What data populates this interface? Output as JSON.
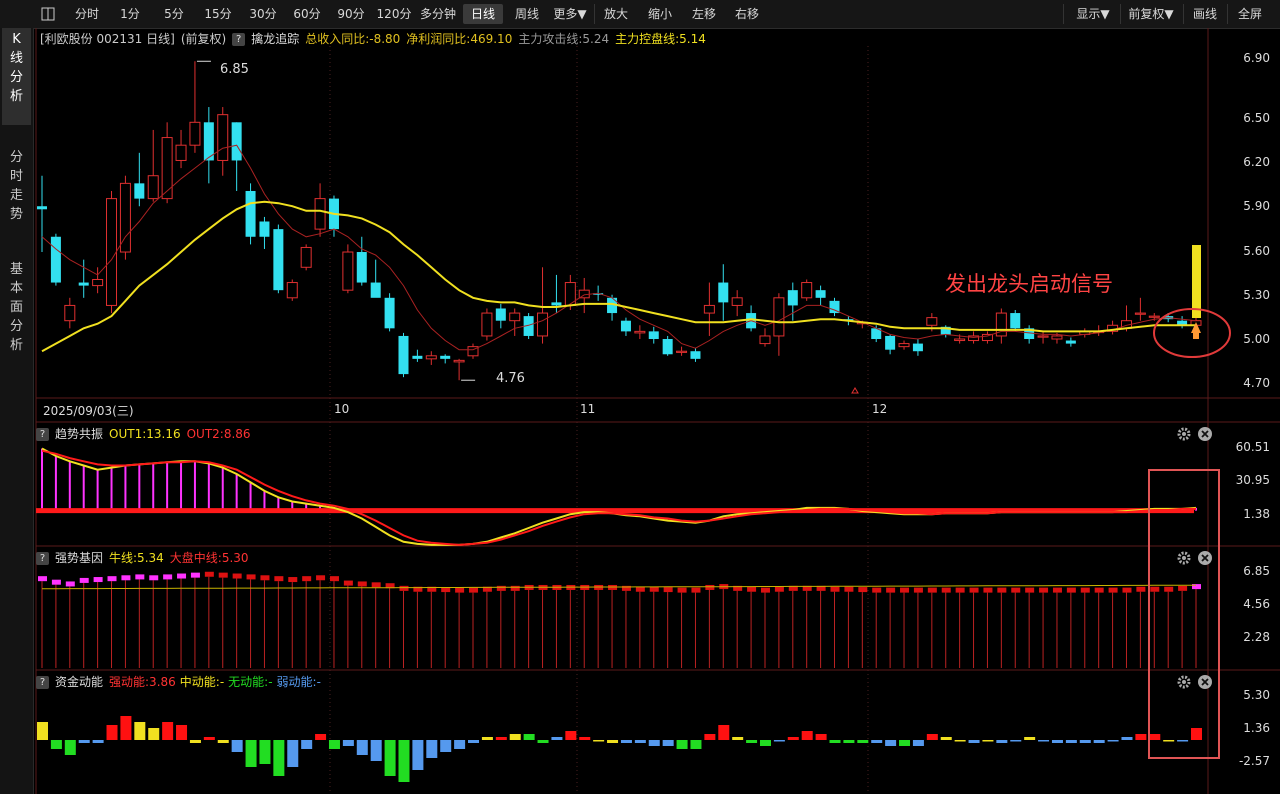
{
  "toolbar": {
    "items": [
      {
        "label": "分时"
      },
      {
        "label": "1分"
      },
      {
        "label": "5分"
      },
      {
        "label": "15分"
      },
      {
        "label": "30分"
      },
      {
        "label": "60分"
      },
      {
        "label": "90分"
      },
      {
        "label": "120分"
      },
      {
        "label": "多分钟"
      },
      {
        "label": "日线",
        "active": true
      },
      {
        "label": "周线"
      },
      {
        "label": "更多▼"
      },
      {
        "label": "放大"
      },
      {
        "label": "缩小"
      },
      {
        "label": "左移"
      },
      {
        "label": "右移"
      }
    ],
    "right": [
      {
        "label": "显示▼"
      },
      {
        "label": "前复权▼"
      },
      {
        "label": "画线"
      },
      {
        "label": "全屏"
      }
    ]
  },
  "sidebar": {
    "tabs": [
      {
        "label": "K\n线\n分\n析",
        "active": true
      },
      {
        "label": "分\n时\n走\n势"
      },
      {
        "label": "基\n本\n面\n分\n析"
      }
    ]
  },
  "main": {
    "stock": "[利欧股份 002131 日线]",
    "adjust": "(前复权)",
    "indicator": "擒龙追踪",
    "stat1": "总收入同比:-8.80",
    "stat2": "净利润同比:469.10",
    "stat3": "主力攻击线:5.24",
    "stat4": "主力控盘线:5.14",
    "annotation": "发出龙头启动信号",
    "high_label": "6.85",
    "low_label": "4.76",
    "axis": [
      "6.90",
      "6.50",
      "6.20",
      "5.90",
      "5.60",
      "5.30",
      "5.00",
      "4.70"
    ],
    "dates": [
      "2025/09/03(三)",
      "10",
      "11",
      "12"
    ]
  },
  "panel1": {
    "title": "趋势共振",
    "out1": "OUT1:13.16",
    "out2": "OUT2:8.86",
    "axis": [
      "60.51",
      "30.95",
      "1.38"
    ]
  },
  "panel2": {
    "title": "强势基因",
    "niu": "牛线:5.34",
    "dapan": "大盘中线:5.30",
    "axis": [
      "6.85",
      "4.56",
      "2.28"
    ]
  },
  "panel3": {
    "title": "资金动能",
    "strong": "强动能:3.86",
    "mid": "中动能:-",
    "none": "无动能:-",
    "weak": "弱动能:-",
    "axis": [
      "5.30",
      "1.36",
      "-2.57"
    ]
  },
  "colors": {
    "up": "#e03030",
    "down": "#33e0f0",
    "yellow": "#f0e020",
    "magenta": "#ff33ff",
    "green": "#22cc22",
    "blue": "#5599ee",
    "red": "#ff1a1a"
  },
  "chart_data": {
    "type": "candlestick",
    "ylim": [
      4.65,
      6.95
    ],
    "candles": [
      [
        5.9,
        5.88,
        6.1,
        5.6
      ],
      [
        5.7,
        5.4,
        5.72,
        5.38
      ],
      [
        5.15,
        5.25,
        5.3,
        5.1
      ],
      [
        5.4,
        5.38,
        5.55,
        5.3
      ],
      [
        5.38,
        5.42,
        5.5,
        5.33
      ],
      [
        5.25,
        5.95,
        6.0,
        5.2
      ],
      [
        5.6,
        6.05,
        6.1,
        5.55
      ],
      [
        6.05,
        5.95,
        6.25,
        5.9
      ],
      [
        5.95,
        6.1,
        6.4,
        5.93
      ],
      [
        5.95,
        6.35,
        6.45,
        5.92
      ],
      [
        6.2,
        6.3,
        6.4,
        6.15
      ],
      [
        6.3,
        6.45,
        6.85,
        6.25
      ],
      [
        6.45,
        6.2,
        6.55,
        6.05
      ],
      [
        6.2,
        6.5,
        6.55,
        6.1
      ],
      [
        6.45,
        6.2,
        6.45,
        6.0
      ],
      [
        6.0,
        5.7,
        6.05,
        5.65
      ],
      [
        5.8,
        5.7,
        5.83,
        5.62
      ],
      [
        5.75,
        5.35,
        5.78,
        5.33
      ],
      [
        5.3,
        5.4,
        5.42,
        5.28
      ],
      [
        5.5,
        5.63,
        5.65,
        5.48
      ],
      [
        5.75,
        5.95,
        6.05,
        5.7
      ],
      [
        5.95,
        5.75,
        5.97,
        5.7
      ],
      [
        5.35,
        5.6,
        5.65,
        5.33
      ],
      [
        5.6,
        5.4,
        5.7,
        5.38
      ],
      [
        5.4,
        5.3,
        5.55,
        5.32
      ],
      [
        5.3,
        5.1,
        5.33,
        5.08
      ],
      [
        5.05,
        4.8,
        5.07,
        4.78
      ],
      [
        4.92,
        4.9,
        4.96,
        4.88
      ],
      [
        4.9,
        4.92,
        4.95,
        4.86
      ],
      [
        4.92,
        4.9,
        4.93,
        4.87
      ],
      [
        4.88,
        4.89,
        4.9,
        4.76
      ],
      [
        4.92,
        4.98,
        5.0,
        4.9
      ],
      [
        5.05,
        5.2,
        5.23,
        5.02
      ],
      [
        5.23,
        5.15,
        5.26,
        5.1
      ],
      [
        5.15,
        5.2,
        5.23,
        5.05
      ],
      [
        5.18,
        5.05,
        5.2,
        5.03
      ],
      [
        5.05,
        5.2,
        5.5,
        5.0
      ],
      [
        5.27,
        5.25,
        5.45,
        5.2
      ],
      [
        5.25,
        5.4,
        5.45,
        5.22
      ],
      [
        5.3,
        5.35,
        5.43,
        5.2
      ],
      [
        5.33,
        5.32,
        5.38,
        5.28
      ],
      [
        5.3,
        5.2,
        5.32,
        5.15
      ],
      [
        5.15,
        5.08,
        5.17,
        5.05
      ],
      [
        5.07,
        5.08,
        5.12,
        5.03
      ],
      [
        5.08,
        5.03,
        5.11,
        5.0
      ],
      [
        5.03,
        4.93,
        5.05,
        4.92
      ],
      [
        4.95,
        4.95,
        4.98,
        4.92
      ],
      [
        4.95,
        4.9,
        4.97,
        4.88
      ],
      [
        5.2,
        5.25,
        5.4,
        5.05
      ],
      [
        5.4,
        5.27,
        5.52,
        5.15
      ],
      [
        5.25,
        5.3,
        5.35,
        5.18
      ],
      [
        5.2,
        5.1,
        5.25,
        5.08
      ],
      [
        5.0,
        5.05,
        5.1,
        4.98
      ],
      [
        5.05,
        5.3,
        5.33,
        4.92
      ],
      [
        5.35,
        5.25,
        5.4,
        5.15
      ],
      [
        5.3,
        5.4,
        5.42,
        5.28
      ],
      [
        5.35,
        5.3,
        5.38,
        5.25
      ],
      [
        5.28,
        5.2,
        5.3,
        5.18
      ],
      [
        5.16,
        5.15,
        5.18,
        5.12
      ],
      [
        5.13,
        5.14,
        5.15,
        5.1
      ],
      [
        5.1,
        5.03,
        5.12,
        5.01
      ],
      [
        5.05,
        4.96,
        5.06,
        4.93
      ],
      [
        4.98,
        5.0,
        5.02,
        4.96
      ],
      [
        5.0,
        4.95,
        5.03,
        4.92
      ],
      [
        5.12,
        5.17,
        5.2,
        5.08
      ],
      [
        5.11,
        5.06,
        5.12,
        5.04
      ],
      [
        5.02,
        5.03,
        5.06,
        5.0
      ],
      [
        5.02,
        5.05,
        5.08,
        5.0
      ],
      [
        5.02,
        5.06,
        5.08,
        5.0
      ],
      [
        5.05,
        5.2,
        5.23,
        5.0
      ],
      [
        5.2,
        5.1,
        5.22,
        5.08
      ],
      [
        5.1,
        5.03,
        5.12,
        5.0
      ],
      [
        5.05,
        5.05,
        5.08,
        5.0
      ],
      [
        5.03,
        5.05,
        5.07,
        5.0
      ],
      [
        5.02,
        5.0,
        5.04,
        4.98
      ],
      [
        5.06,
        5.08,
        5.1,
        5.04
      ],
      [
        5.08,
        5.08,
        5.12,
        5.05
      ],
      [
        5.08,
        5.12,
        5.15,
        5.06
      ],
      [
        5.1,
        5.15,
        5.25,
        5.08
      ],
      [
        5.2,
        5.2,
        5.3,
        5.15
      ],
      [
        5.18,
        5.18,
        5.2,
        5.15
      ],
      [
        5.18,
        5.16,
        5.2,
        5.14
      ],
      [
        5.15,
        5.12,
        5.18,
        5.1
      ],
      [
        5.12,
        5.15,
        5.18,
        5.1
      ]
    ],
    "ma_fast": [
      5.7,
      5.62,
      5.55,
      5.5,
      5.45,
      5.55,
      5.7,
      5.8,
      5.92,
      6.0,
      6.08,
      6.15,
      6.22,
      6.28,
      6.3,
      6.15,
      5.98,
      5.85,
      5.75,
      5.7,
      5.72,
      5.75,
      5.7,
      5.62,
      5.58,
      5.5,
      5.38,
      5.22,
      5.1,
      5.02,
      4.96,
      4.96,
      5.0,
      5.05,
      5.1,
      5.12,
      5.15,
      5.2,
      5.26,
      5.32,
      5.33,
      5.3,
      5.22,
      5.16,
      5.12,
      5.08,
      5.0,
      4.97,
      5.02,
      5.08,
      5.12,
      5.15,
      5.12,
      5.15,
      5.2,
      5.25,
      5.25,
      5.22,
      5.18,
      5.14,
      5.1,
      5.06,
      5.04,
      5.03,
      5.05,
      5.06,
      5.05,
      5.04,
      5.05,
      5.08,
      5.08,
      5.07,
      5.06,
      5.06,
      5.05,
      5.06,
      5.07,
      5.09,
      5.12,
      5.14,
      5.16,
      5.17,
      5.16,
      5.15
    ],
    "ma_slow": [
      4.95,
      5.0,
      5.05,
      5.1,
      5.13,
      5.18,
      5.28,
      5.38,
      5.45,
      5.52,
      5.6,
      5.68,
      5.75,
      5.82,
      5.88,
      5.92,
      5.93,
      5.92,
      5.9,
      5.87,
      5.87,
      5.85,
      5.84,
      5.82,
      5.78,
      5.73,
      5.65,
      5.58,
      5.5,
      5.42,
      5.35,
      5.3,
      5.28,
      5.27,
      5.27,
      5.25,
      5.24,
      5.24,
      5.25,
      5.26,
      5.26,
      5.26,
      5.24,
      5.22,
      5.2,
      5.18,
      5.16,
      5.14,
      5.14,
      5.14,
      5.15,
      5.16,
      5.15,
      5.14,
      5.14,
      5.15,
      5.16,
      5.16,
      5.15,
      5.14,
      5.13,
      5.11,
      5.1,
      5.1,
      5.1,
      5.1,
      5.09,
      5.09,
      5.09,
      5.09,
      5.09,
      5.09,
      5.08,
      5.08,
      5.08,
      5.08,
      5.08,
      5.09,
      5.1,
      5.11,
      5.12,
      5.12,
      5.12,
      5.12
    ],
    "trend_out1": [
      60,
      53,
      48,
      44,
      40,
      42,
      44,
      45,
      46,
      47,
      48,
      48,
      46,
      42,
      36,
      28,
      20,
      14,
      10,
      8,
      6,
      4,
      0,
      -6,
      -14,
      -22,
      -28,
      -30,
      -31,
      -31,
      -31,
      -30,
      -28,
      -24,
      -20,
      -15,
      -10,
      -6,
      -2,
      0,
      0,
      -1,
      -3,
      -4,
      -6,
      -8,
      -9,
      -10,
      -8,
      -4,
      -2,
      -1,
      0,
      1,
      2,
      4,
      4,
      4,
      3,
      1,
      0,
      -1,
      -2,
      -2,
      -2,
      -1,
      -1,
      -1,
      -1,
      0,
      0,
      0,
      0,
      0,
      0,
      0,
      0,
      0,
      1,
      2,
      3,
      3,
      3,
      4
    ],
    "trend_out2": [
      58,
      55,
      51,
      48,
      45,
      44,
      44,
      45,
      46,
      47,
      47,
      48,
      47,
      44,
      40,
      33,
      26,
      20,
      15,
      11,
      8,
      6,
      3,
      -2,
      -8,
      -15,
      -22,
      -27,
      -29,
      -30,
      -31,
      -30,
      -29,
      -26,
      -22,
      -18,
      -13,
      -9,
      -5,
      -2,
      -1,
      -1,
      -2,
      -3,
      -5,
      -6,
      -8,
      -9,
      -8,
      -6,
      -4,
      -2,
      -1,
      0,
      1,
      2,
      3,
      3,
      3,
      2,
      1,
      0,
      -1,
      -1,
      -2,
      -1,
      -1,
      -1,
      -1,
      0,
      0,
      0,
      0,
      0,
      0,
      0,
      0,
      0,
      0,
      1,
      2,
      2,
      3,
      3
    ],
    "gene_values": [
      6.6,
      6.4,
      6.3,
      6.5,
      6.55,
      6.6,
      6.65,
      6.7,
      6.65,
      6.7,
      6.75,
      6.8,
      6.85,
      6.8,
      6.75,
      6.7,
      6.65,
      6.6,
      6.55,
      6.6,
      6.65,
      6.6,
      6.35,
      6.3,
      6.25,
      6.2,
      6.05,
      6.0,
      6.0,
      5.98,
      5.95,
      5.95,
      6.0,
      6.05,
      6.05,
      6.1,
      6.1,
      6.1,
      6.1,
      6.1,
      6.1,
      6.1,
      6.05,
      6.0,
      6.0,
      5.98,
      5.95,
      5.95,
      6.1,
      6.15,
      6.05,
      6.0,
      5.95,
      6.0,
      6.05,
      6.05,
      6.05,
      6.0,
      6.0,
      5.98,
      5.95,
      5.95,
      5.95,
      5.95,
      5.95,
      5.95,
      5.95,
      5.95,
      5.95,
      5.95,
      5.95,
      5.95,
      5.95,
      5.95,
      5.95,
      5.95,
      5.95,
      5.95,
      5.95,
      6.0,
      6.0,
      6.0,
      6.05,
      6.15
    ],
    "momentum": [
      6,
      -3,
      -5,
      -1,
      -1,
      5,
      8,
      6,
      4,
      6,
      5,
      -1,
      1,
      -1,
      -4,
      -9,
      -8,
      -12,
      -9,
      -3,
      2,
      -3,
      -2,
      -5,
      -7,
      -12,
      -14,
      -10,
      -6,
      -4,
      -3,
      -1,
      1,
      1,
      2,
      2,
      -1,
      1,
      3,
      1,
      0,
      -1,
      -1,
      -1,
      -2,
      -2,
      -3,
      -3,
      2,
      5,
      1,
      -1,
      -2,
      0,
      1,
      3,
      2,
      -1,
      -1,
      -1,
      -1,
      -2,
      -2,
      -2,
      2,
      1,
      0,
      -1,
      0,
      -1,
      0,
      1,
      0,
      -1,
      -1,
      -1,
      -1,
      0,
      1,
      2,
      2,
      0,
      0,
      4
    ],
    "momentum_colors": [
      "y",
      "g",
      "g",
      "b",
      "b",
      "r",
      "r",
      "y",
      "y",
      "r",
      "r",
      "y",
      "r",
      "y",
      "b",
      "g",
      "g",
      "g",
      "b",
      "b",
      "r",
      "g",
      "b",
      "b",
      "b",
      "g",
      "g",
      "b",
      "b",
      "b",
      "b",
      "b",
      "y",
      "r",
      "y",
      "g",
      "g",
      "b",
      "r",
      "r",
      "y",
      "y",
      "b",
      "b",
      "b",
      "b",
      "g",
      "g",
      "r",
      "r",
      "y",
      "g",
      "g",
      "b",
      "r",
      "r",
      "r",
      "g",
      "g",
      "g",
      "b",
      "b",
      "g",
      "b",
      "r",
      "y",
      "y",
      "b",
      "y",
      "b",
      "b",
      "y",
      "b",
      "b",
      "b",
      "b",
      "b",
      "b",
      "b",
      "r",
      "r",
      "y",
      "b",
      "r"
    ]
  }
}
